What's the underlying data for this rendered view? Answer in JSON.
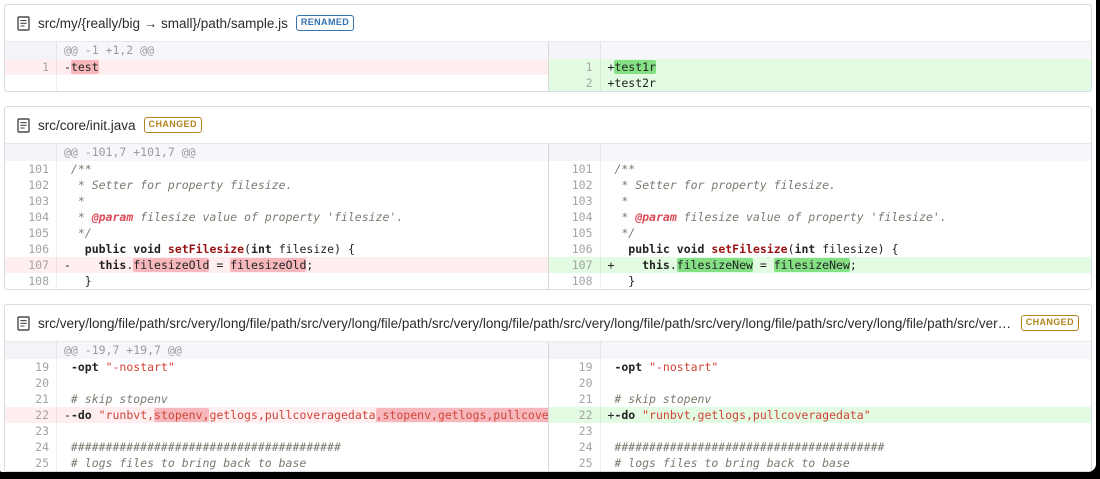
{
  "colors": {
    "card_border": "#d9dce1",
    "divider": "#d8d8d8",
    "num_text": "#a3a3a3",
    "code_text": "#222222",
    "hunk_bg": "#f5f7fa",
    "hunk_gutter_bg": "#f2f4f8",
    "hunk_text": "#9b9b9b",
    "del_line_bg": "#ffeef0",
    "del_word_bg": "#f7b8bd",
    "add_line_bg": "#e2fbe2",
    "add_word_bg": "#85e085",
    "comment_text": "#7b7a6f",
    "string_text": "#d04437",
    "function_text": "#991111",
    "doctag_text": "#dd4a58",
    "renamed_badge": "#3572b0",
    "changed_badge": "#b3861f"
  },
  "files": [
    {
      "path": "src/my/{really/big → small}/path/sample.js",
      "badge": {
        "label": "RENAMED",
        "color": "#3572b0"
      },
      "hunk": "@@ -1 +1,2 @@",
      "rows": [
        {
          "left": {
            "num": "1",
            "type": "del",
            "segs": [
              [
                "-",
                "plain"
              ],
              [
                "test",
                "delw"
              ]
            ]
          },
          "right": {
            "num": "1",
            "type": "add",
            "segs": [
              [
                "+",
                "plain"
              ],
              [
                "test1r",
                "addw"
              ]
            ]
          }
        },
        {
          "left": {
            "type": "empty",
            "segs": []
          },
          "right": {
            "num": "2",
            "type": "add",
            "segs": [
              [
                "+test2r",
                "plain"
              ]
            ]
          }
        }
      ]
    },
    {
      "path": "src/core/init.java",
      "badge": {
        "label": "CHANGED",
        "color": "#b3861f"
      },
      "hunk": "@@ -101,7 +101,7 @@",
      "rows": [
        {
          "left": {
            "num": "101",
            "type": "ctx",
            "segs": [
              [
                " /**",
                "com"
              ]
            ]
          },
          "right": {
            "num": "101",
            "type": "ctx",
            "segs": [
              [
                " /**",
                "com"
              ]
            ]
          }
        },
        {
          "left": {
            "num": "102",
            "type": "ctx",
            "segs": [
              [
                "  * Setter for property filesize.",
                "com"
              ]
            ]
          },
          "right": {
            "num": "102",
            "type": "ctx",
            "segs": [
              [
                "  * Setter for property filesize.",
                "com"
              ]
            ]
          }
        },
        {
          "left": {
            "num": "103",
            "type": "ctx",
            "segs": [
              [
                "  *",
                "com"
              ]
            ]
          },
          "right": {
            "num": "103",
            "type": "ctx",
            "segs": [
              [
                "  *",
                "com"
              ]
            ]
          }
        },
        {
          "left": {
            "num": "104",
            "type": "ctx",
            "segs": [
              [
                "  * ",
                "com"
              ],
              [
                "@param",
                "tag"
              ],
              [
                " filesize value of property 'filesize'.",
                "com"
              ]
            ]
          },
          "right": {
            "num": "104",
            "type": "ctx",
            "segs": [
              [
                "  * ",
                "com"
              ],
              [
                "@param",
                "tag"
              ],
              [
                " filesize value of property 'filesize'.",
                "com"
              ]
            ]
          }
        },
        {
          "left": {
            "num": "105",
            "type": "ctx",
            "segs": [
              [
                "  */",
                "com"
              ]
            ]
          },
          "right": {
            "num": "105",
            "type": "ctx",
            "segs": [
              [
                "  */",
                "com"
              ]
            ]
          }
        },
        {
          "left": {
            "num": "106",
            "type": "ctx",
            "segs": [
              [
                "   ",
                "plain"
              ],
              [
                "public",
                "kw"
              ],
              [
                " ",
                "plain"
              ],
              [
                "void",
                "kw"
              ],
              [
                " ",
                "plain"
              ],
              [
                "setFilesize",
                "fn"
              ],
              [
                "(",
                "plain"
              ],
              [
                "int",
                "kw"
              ],
              [
                " filesize) {",
                "plain"
              ]
            ]
          },
          "right": {
            "num": "106",
            "type": "ctx",
            "segs": [
              [
                "   ",
                "plain"
              ],
              [
                "public",
                "kw"
              ],
              [
                " ",
                "plain"
              ],
              [
                "void",
                "kw"
              ],
              [
                " ",
                "plain"
              ],
              [
                "setFilesize",
                "fn"
              ],
              [
                "(",
                "plain"
              ],
              [
                "int",
                "kw"
              ],
              [
                " filesize) {",
                "plain"
              ]
            ]
          }
        },
        {
          "left": {
            "num": "107",
            "type": "del",
            "segs": [
              [
                "-    ",
                "plain"
              ],
              [
                "this",
                "kw"
              ],
              [
                ".",
                "plain"
              ],
              [
                "filesizeOld",
                "delw"
              ],
              [
                " = ",
                "plain"
              ],
              [
                "filesizeOld",
                "delw"
              ],
              [
                ";",
                "plain"
              ]
            ]
          },
          "right": {
            "num": "107",
            "type": "add",
            "segs": [
              [
                "+    ",
                "plain"
              ],
              [
                "this",
                "kw"
              ],
              [
                ".",
                "plain"
              ],
              [
                "filesizeNew",
                "addw"
              ],
              [
                " = ",
                "plain"
              ],
              [
                "filesizeNew",
                "addw"
              ],
              [
                ";",
                "plain"
              ]
            ]
          }
        },
        {
          "left": {
            "num": "108",
            "type": "ctx",
            "segs": [
              [
                "   }",
                "plain"
              ]
            ]
          },
          "right": {
            "num": "108",
            "type": "ctx",
            "segs": [
              [
                "   }",
                "plain"
              ]
            ]
          }
        }
      ]
    },
    {
      "path": "src/very/long/file/path/src/very/long/file/path/src/very/long/file/path/src/very/long/file/path/src/very/long/file/path/src/very/long/file/path/src/very/long/file/path/src/very/long/file/path/src/very/long/file/path/",
      "badge": {
        "label": "CHANGED",
        "color": "#b3861f"
      },
      "hunk": "@@ -19,7 +19,7 @@",
      "rows": [
        {
          "left": {
            "num": "19",
            "type": "ctx",
            "segs": [
              [
                " ",
                "plain"
              ],
              [
                "-opt",
                "kw"
              ],
              [
                " ",
                "plain"
              ],
              [
                "\"-nostart\"",
                "str"
              ]
            ]
          },
          "right": {
            "num": "19",
            "type": "ctx",
            "segs": [
              [
                " ",
                "plain"
              ],
              [
                "-opt",
                "kw"
              ],
              [
                " ",
                "plain"
              ],
              [
                "\"-nostart\"",
                "str"
              ]
            ]
          }
        },
        {
          "left": {
            "num": "20",
            "type": "ctx",
            "segs": []
          },
          "right": {
            "num": "20",
            "type": "ctx",
            "segs": []
          }
        },
        {
          "left": {
            "num": "21",
            "type": "ctx",
            "segs": [
              [
                " # skip stopenv",
                "com"
              ]
            ]
          },
          "right": {
            "num": "21",
            "type": "ctx",
            "segs": [
              [
                " # skip stopenv",
                "com"
              ]
            ]
          }
        },
        {
          "left": {
            "num": "22",
            "type": "del",
            "segs": [
              [
                "-",
                "plain"
              ],
              [
                "-do",
                "kw"
              ],
              [
                " ",
                "plain"
              ],
              [
                "\"runbvt,",
                "str"
              ],
              [
                "stopenv,",
                "str-delw"
              ],
              [
                "getlogs,pullcoveragedata",
                "str"
              ],
              [
                ",stopenv,getlogs,pullcoveragedata\"",
                "str-delw"
              ]
            ]
          },
          "right": {
            "num": "22",
            "type": "add",
            "segs": [
              [
                "+",
                "plain"
              ],
              [
                "-do",
                "kw"
              ],
              [
                " ",
                "plain"
              ],
              [
                "\"runbvt,getlogs,pullcoveragedata\"",
                "str"
              ]
            ]
          }
        },
        {
          "left": {
            "num": "23",
            "type": "ctx",
            "segs": []
          },
          "right": {
            "num": "23",
            "type": "ctx",
            "segs": []
          }
        },
        {
          "left": {
            "num": "24",
            "type": "ctx",
            "segs": [
              [
                " #######################################",
                "com"
              ]
            ]
          },
          "right": {
            "num": "24",
            "type": "ctx",
            "segs": [
              [
                " #######################################",
                "com"
              ]
            ]
          }
        },
        {
          "left": {
            "num": "25",
            "type": "ctx",
            "segs": [
              [
                " # logs files to bring back to base",
                "com"
              ]
            ]
          },
          "right": {
            "num": "25",
            "type": "ctx",
            "segs": [
              [
                " # logs files to bring back to base",
                "com"
              ]
            ]
          }
        }
      ]
    }
  ]
}
